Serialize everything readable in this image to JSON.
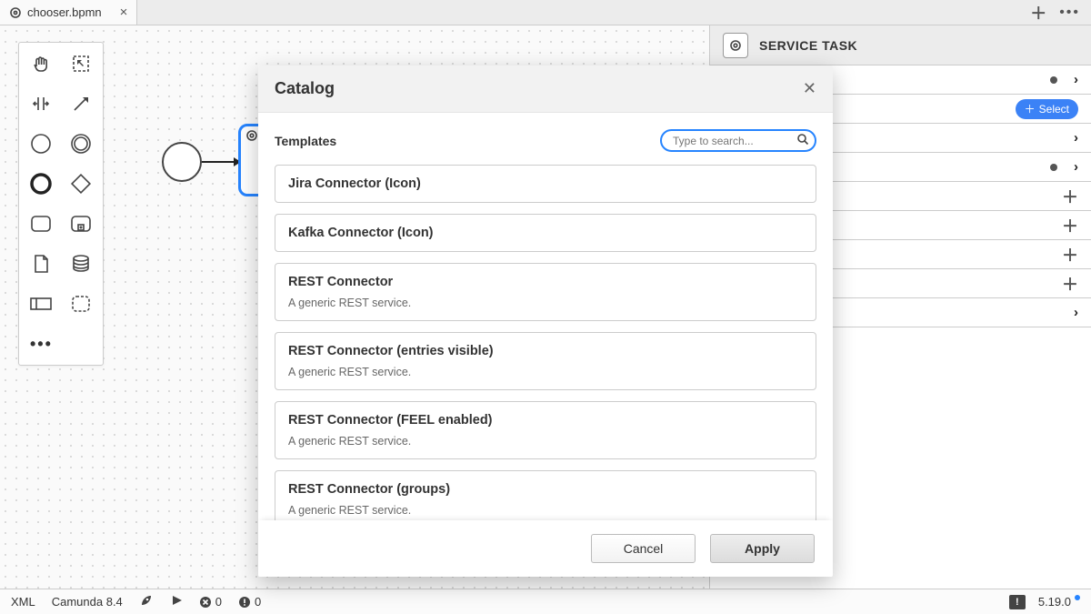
{
  "tab": {
    "filename": "chooser.bpmn"
  },
  "modal": {
    "title": "Catalog",
    "section_label": "Templates",
    "search_placeholder": "Type to search...",
    "templates": [
      {
        "name": "Jira Connector (Icon)"
      },
      {
        "name": "Kafka Connector (Icon)"
      },
      {
        "name": "REST Connector",
        "desc": "A generic REST service."
      },
      {
        "name": "REST Connector (entries visible)",
        "desc": "A generic REST service."
      },
      {
        "name": "REST Connector (FEEL enabled)",
        "desc": "A generic REST service."
      },
      {
        "name": "REST Connector (groups)",
        "desc": "A generic REST service."
      }
    ],
    "buttons": {
      "cancel": "Cancel",
      "apply": "Apply"
    }
  },
  "properties": {
    "title": "SERVICE TASK",
    "select_label": "Select",
    "rows": [
      {
        "kind": "dot-chev"
      },
      {
        "kind": "select"
      },
      {
        "kind": "chev"
      },
      {
        "kind": "dot-chev"
      },
      {
        "kind": "plus"
      },
      {
        "kind": "plus"
      },
      {
        "kind": "plus"
      },
      {
        "kind": "plus"
      },
      {
        "kind": "chev"
      }
    ]
  },
  "status": {
    "xml": "XML",
    "platform": "Camunda 8.4",
    "errors": "0",
    "warnings": "0",
    "version": "5.19.0"
  }
}
